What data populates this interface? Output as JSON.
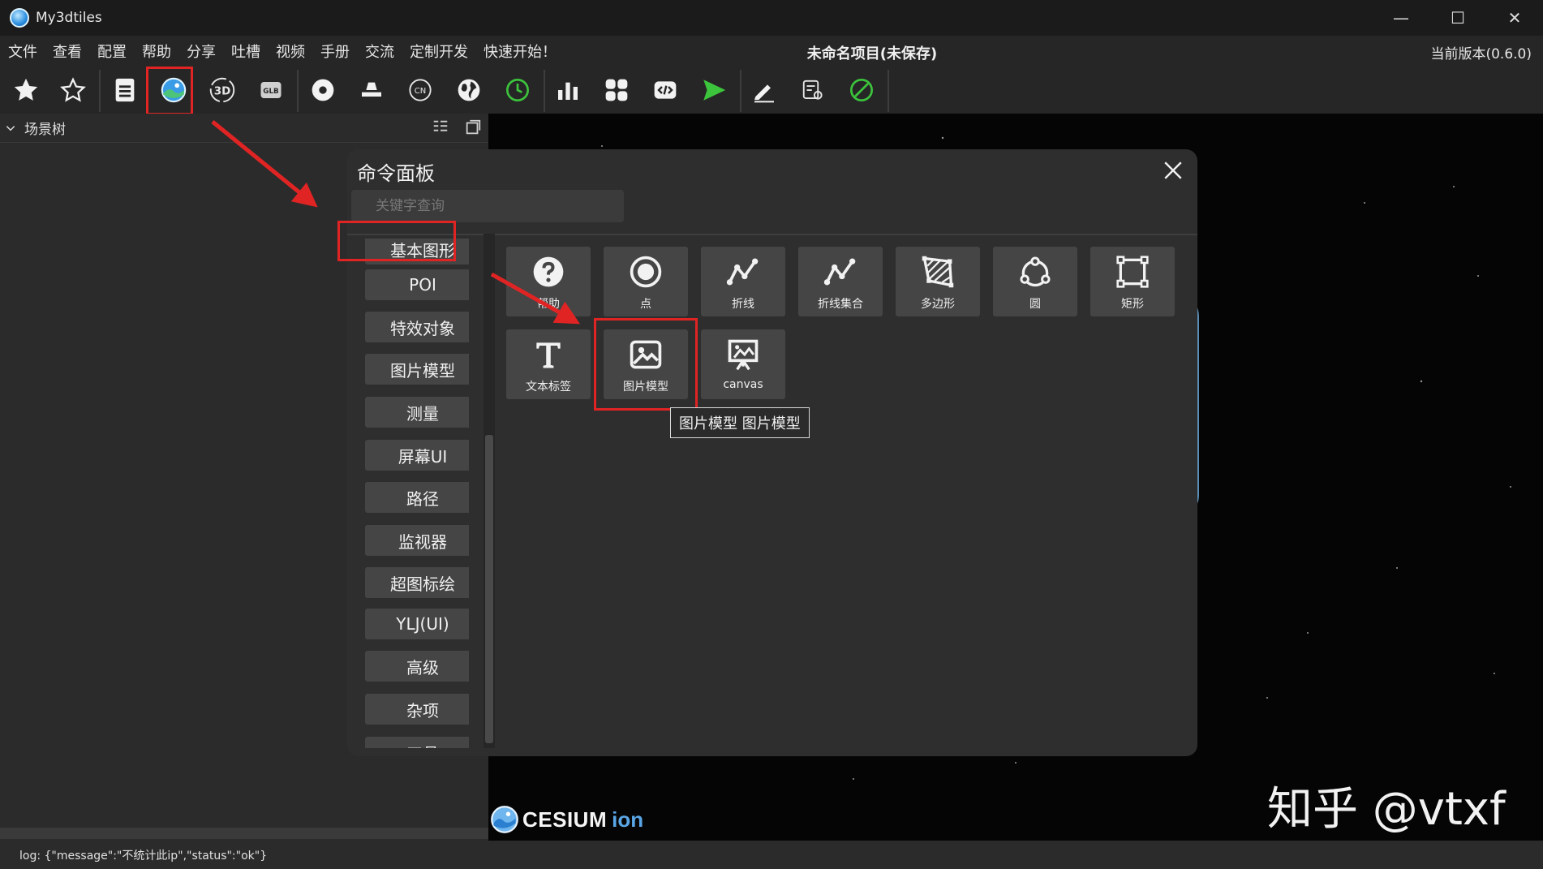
{
  "window": {
    "app_name": "My3dtiles",
    "minimize": "—",
    "maximize": "☐",
    "close": "✕"
  },
  "menu": {
    "items": [
      "文件",
      "查看",
      "配置",
      "帮助",
      "分享",
      "吐槽",
      "视频",
      "手册",
      "交流",
      "定制开发",
      "快速开始！"
    ],
    "project_title": "未命名项目(未保存)",
    "version": "当前版本(0.6.0)"
  },
  "toolbar": {
    "icons": [
      "star-filled-icon",
      "star-outline-icon",
      "document-icon",
      "image-model-icon",
      "3d-icon",
      "glb-icon",
      "location-pin-icon",
      "road-icon",
      "cn-icon",
      "globe-icon",
      "clock-icon",
      "bar-chart-icon",
      "grid-icon",
      "code-icon",
      "play-icon",
      "pen-icon",
      "settings-list-icon",
      "disable-icon"
    ],
    "labels": {
      "three_d": "3D",
      "glb": "GLB",
      "cn": "CN"
    }
  },
  "scene_tree": {
    "title": "场景树"
  },
  "command_panel": {
    "title": "命令面板",
    "search_placeholder": "关键字查询",
    "categories": [
      "基本图形",
      "POI",
      "特效对象",
      "图片模型",
      "测量",
      "屏幕UI",
      "路径",
      "监视器",
      "超图标绘",
      "YLJ(UI)",
      "高级",
      "杂项",
      "工具"
    ],
    "tiles": [
      {
        "label": "帮助",
        "icon": "help-icon"
      },
      {
        "label": "点",
        "icon": "point-icon"
      },
      {
        "label": "折线",
        "icon": "polyline-icon"
      },
      {
        "label": "折线集合",
        "icon": "polyline-collection-icon"
      },
      {
        "label": "多边形",
        "icon": "polygon-icon"
      },
      {
        "label": "圆",
        "icon": "circle-icon"
      },
      {
        "label": "矩形",
        "icon": "rectangle-icon"
      },
      {
        "label": "文本标签",
        "icon": "text-label-icon"
      },
      {
        "label": "图片模型",
        "icon": "image-icon"
      },
      {
        "label": "canvas",
        "icon": "canvas-icon"
      }
    ],
    "tooltip": "图片模型  图片模型"
  },
  "viewer": {
    "logo_main": "CESIUM",
    "logo_sub": "ion",
    "watermark": "知乎 @vtxf"
  },
  "status": {
    "log": "log: {\"message\":\"不统计此ip\",\"status\":\"ok\"}"
  },
  "colors": {
    "highlight": "#e02424",
    "accent_green": "#3cc43c",
    "accent_blue": "#2a8ee0"
  }
}
